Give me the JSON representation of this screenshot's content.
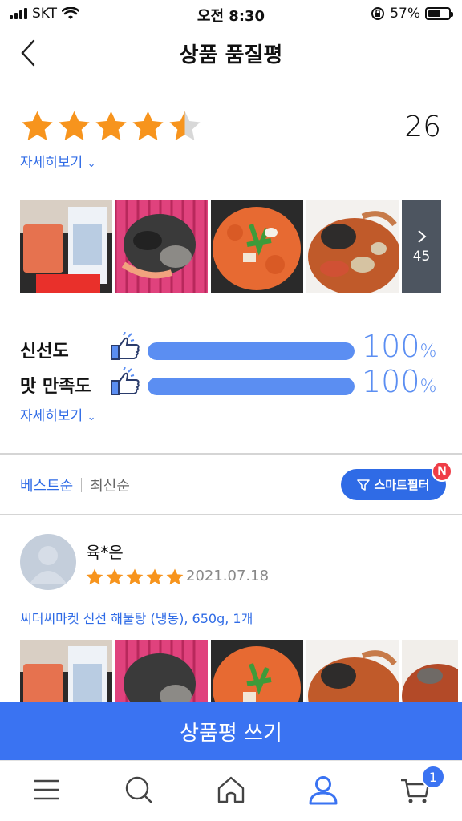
{
  "status_bar": {
    "carrier": "SKT",
    "time": "오전 8:30",
    "battery": "57%"
  },
  "header": {
    "title": "상품 품질평"
  },
  "summary": {
    "rating": 4.5,
    "review_count": "26",
    "detail_link": "자세히보기",
    "more_photo_count": "45"
  },
  "satisfaction": [
    {
      "label": "신선도",
      "percent": "100",
      "unit": "%",
      "fraction": 1.0
    },
    {
      "label": "맛 만족도",
      "percent": "100",
      "unit": "%",
      "fraction": 1.0
    }
  ],
  "sort": {
    "best": "베스트순",
    "latest": "최신순"
  },
  "filter": {
    "label": "스마트필터",
    "badge": "N"
  },
  "review": {
    "name": "육*은",
    "rating": 5,
    "date": "2021.07.18",
    "product": "씨더씨마켓 신선 해물탕 (냉동), 650g, 1개"
  },
  "write_button": {
    "label": "상품평 쓰기"
  },
  "tabbar": {
    "cart_count": "1"
  },
  "colors": {
    "accent": "#3a73f2",
    "star": "#f7941d",
    "link": "#2f6be6",
    "badge_red": "#ef3d47"
  }
}
